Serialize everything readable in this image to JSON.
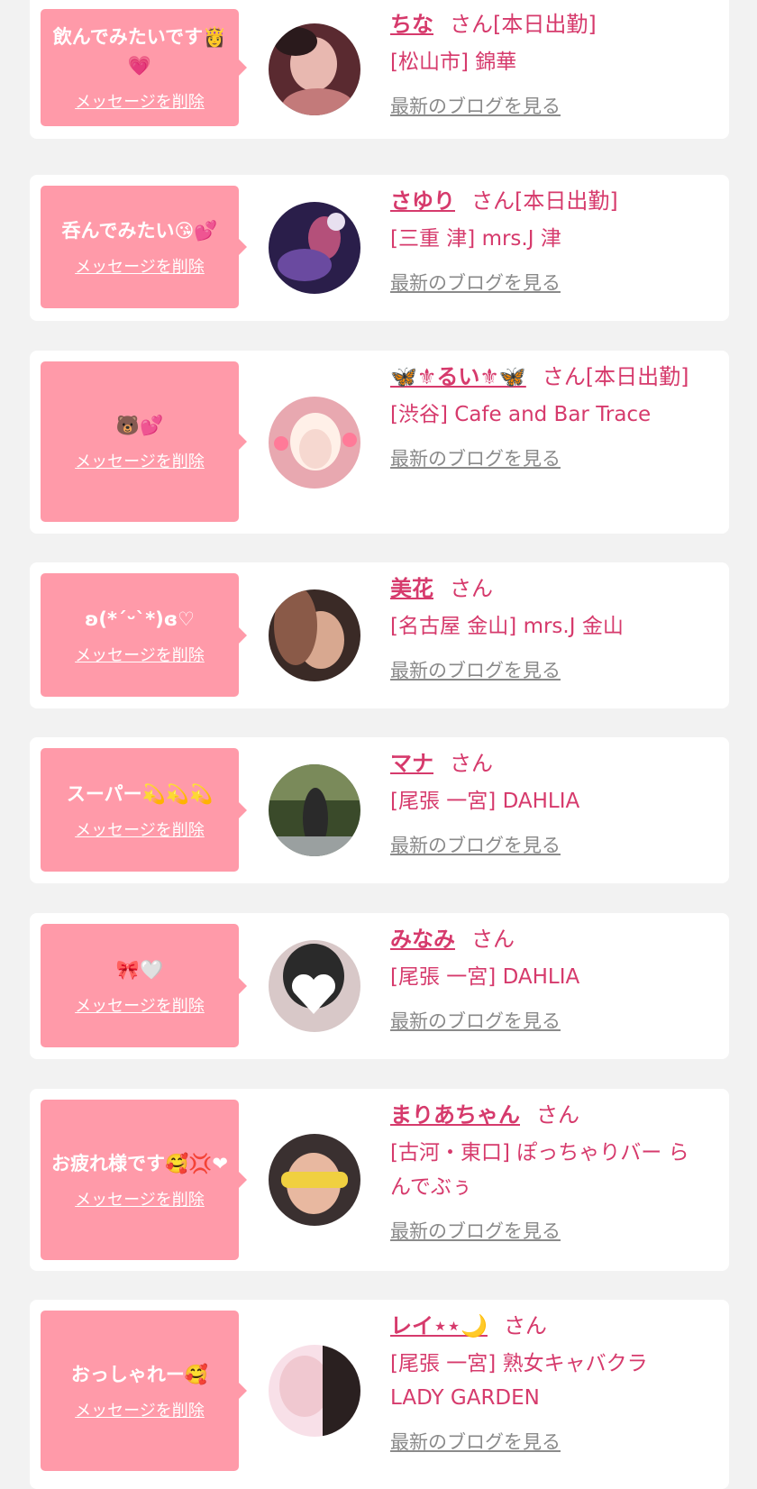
{
  "favorites": [
    {
      "message": "飲んでみたいです👸💗",
      "name": "ちな",
      "san": "さん[本日出勤]",
      "shop": "[松山市] 錦華",
      "blog_link": "最新のブログを見る",
      "delete_label": "メッセージを削除",
      "avatar_colors": [
        "#e8b8b0",
        "#5a2a30",
        "#c37a7a"
      ]
    },
    {
      "message": "呑んでみたい😘💕",
      "name": "さゆり",
      "san": "さん[本日出勤]",
      "shop": "[三重 津] mrs.J 津",
      "blog_link": "最新のブログを見る",
      "delete_label": "メッセージを削除",
      "avatar_colors": [
        "#2a1e4a",
        "#b4507a",
        "#6a4aa0"
      ]
    },
    {
      "message": "🐻💕",
      "name": "🦋⚜るい⚜🦋",
      "san": "さん[本日出勤]",
      "shop": "[渋谷] Cafe and Bar Trace",
      "blog_link": "最新のブログを見る",
      "delete_label": "メッセージを削除",
      "avatar_colors": [
        "#f6d8d0",
        "#e8a8b0",
        "#fff0e8"
      ]
    },
    {
      "message": "ʚ(*ˊᵕˋ*)ɞ♡",
      "name": "美花",
      "san": "さん",
      "shop": "[名古屋 金山] mrs.J 金山",
      "blog_link": "最新のブログを見る",
      "delete_label": "メッセージを削除",
      "avatar_colors": [
        "#3a2a26",
        "#d8a890",
        "#8a5a48"
      ]
    },
    {
      "message": "スーパー💫💫💫",
      "name": "マナ",
      "san": "さん",
      "shop": "[尾張 一宮] DAHLIA",
      "blog_link": "最新のブログを見る",
      "delete_label": "メッセージを削除",
      "avatar_colors": [
        "#3a4a2a",
        "#7a8a5a",
        "#2a2a2a"
      ]
    },
    {
      "message": "🎀🤍",
      "name": "みなみ",
      "san": "さん",
      "shop": "[尾張 一宮] DAHLIA",
      "blog_link": "最新のブログを見る",
      "delete_label": "メッセージを削除",
      "avatar_colors": [
        "#2a2a2a",
        "#ffffff",
        "#d8c8c8"
      ]
    },
    {
      "message": "お疲れ様です🥰💢❤",
      "name": "まりあちゃん",
      "san": "さん",
      "shop": "[古河・東口] ぽっちゃりバー らんでぶぅ",
      "blog_link": "最新のブログを見る",
      "delete_label": "メッセージを削除",
      "avatar_colors": [
        "#3a3030",
        "#e8b8a0",
        "#f0d040"
      ]
    },
    {
      "message": "おっしゃれー🥰",
      "name": "レイ⋆⋆🌙",
      "san": "さん",
      "shop": "[尾張 一宮] 熟女キャバクラ LADY GARDEN",
      "blog_link": "最新のブログを見る",
      "delete_label": "メッセージを削除",
      "avatar_colors": [
        "#f0c8d0",
        "#2a2020",
        "#f8e0e8"
      ]
    }
  ]
}
